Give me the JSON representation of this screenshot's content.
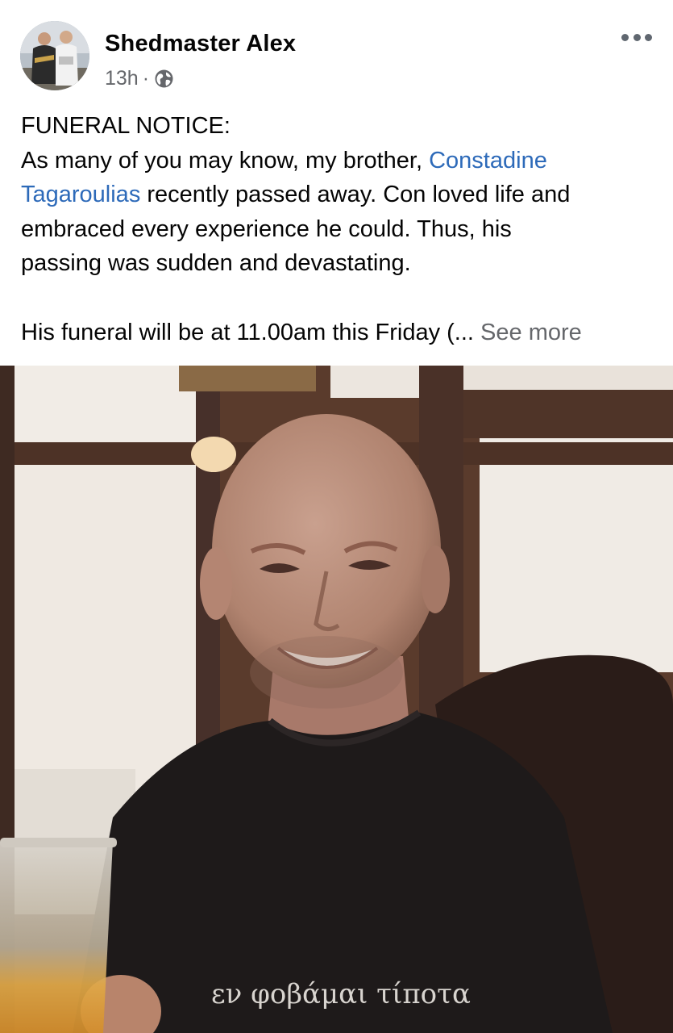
{
  "post": {
    "author": "Shedmaster Alex",
    "timestamp": "13h",
    "separator": "·",
    "privacy_icon": "globe-icon",
    "more_icon": "more-options-icon",
    "text": {
      "heading": "FUNERAL NOTICE:",
      "p1_line1_a": "As many of you may know, my brother, ",
      "p1_line1_link": "Constadine",
      "p1_line2_link": "Tagaroulias",
      "p1_line2_b": " recently passed away. Con loved life and",
      "p1_line3": "embraced every experience he could. Thus, his",
      "p1_line4": "passing was sudden and devastating.",
      "p2": "His funeral will be at 11.00am this Friday (... ",
      "see_more": "See more"
    },
    "photo": {
      "shirt_text": "εν φοβάμαι τίποτα"
    }
  },
  "colors": {
    "link": "#2d6ab9",
    "secondary_text": "#65676b",
    "primary_text": "#050505"
  }
}
